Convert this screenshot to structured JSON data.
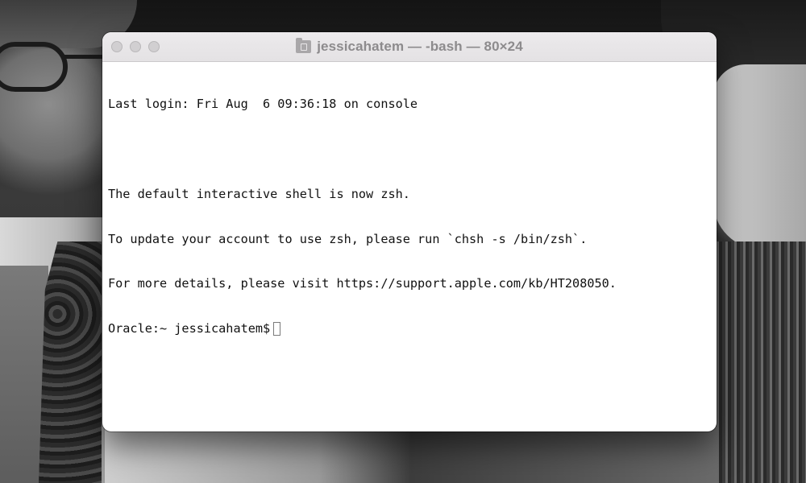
{
  "window": {
    "title": "jessicahatem — -bash — 80×24",
    "title_icon": "home-folder-icon",
    "traffic_lights": [
      "close",
      "minimize",
      "zoom"
    ]
  },
  "terminal": {
    "lines": [
      "Last login: Fri Aug  6 09:36:18 on console",
      "",
      "The default interactive shell is now zsh.",
      "To update your account to use zsh, please run `chsh -s /bin/zsh`.",
      "For more details, please visit https://support.apple.com/kb/HT208050."
    ],
    "prompt": "Oracle:~ jessicahatem$"
  },
  "colors": {
    "window_bg": "#ffffff",
    "titlebar_bg": "#e6e4e6",
    "text": "#111111",
    "title_text": "#8d8b8d"
  }
}
